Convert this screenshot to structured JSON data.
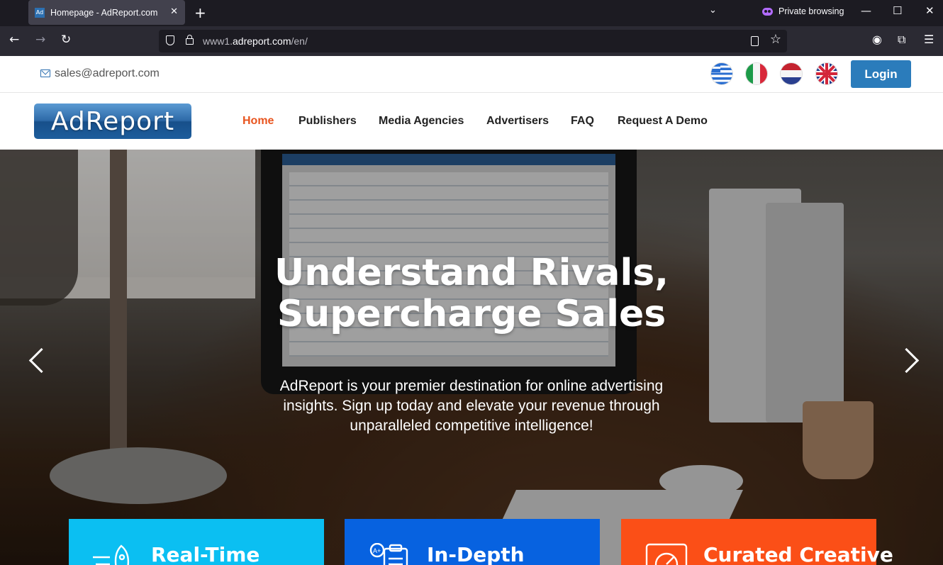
{
  "browser": {
    "tab_title": "Homepage - AdReport.com",
    "favicon_text": "Ad",
    "private_label": "Private browsing",
    "url_prefix": "www1.",
    "url_domain": "adreport.com",
    "url_path": "/en/"
  },
  "topbar": {
    "email": "sales@adreport.com",
    "login_label": "Login",
    "languages": [
      "Greek",
      "Italian",
      "Dutch",
      "English"
    ]
  },
  "header": {
    "logo_text": "AdReport",
    "menu": [
      {
        "label": "Home",
        "active": true
      },
      {
        "label": "Publishers"
      },
      {
        "label": "Media Agencies"
      },
      {
        "label": "Advertisers"
      },
      {
        "label": "FAQ"
      },
      {
        "label": "Request A Demo"
      }
    ]
  },
  "hero": {
    "title_line1": "Understand Rivals,",
    "title_line2": "Supercharge Sales",
    "subtitle": "AdReport is your premier destination for online advertising insights. Sign up today and elevate your revenue through unparalleled competitive intelligence!"
  },
  "cards": [
    {
      "title": "Real-Time",
      "icon": "rocket-icon",
      "color": "#0bbff2"
    },
    {
      "title": "In-Depth",
      "icon": "clipboard-icon",
      "color": "#0762e0"
    },
    {
      "title": "Curated Creative",
      "icon": "gauge-icon",
      "color": "#fb4f17"
    }
  ],
  "colors": {
    "accent": "#e8541e",
    "login": "#2b7cbb",
    "email_icon": "#2c6fb0"
  }
}
